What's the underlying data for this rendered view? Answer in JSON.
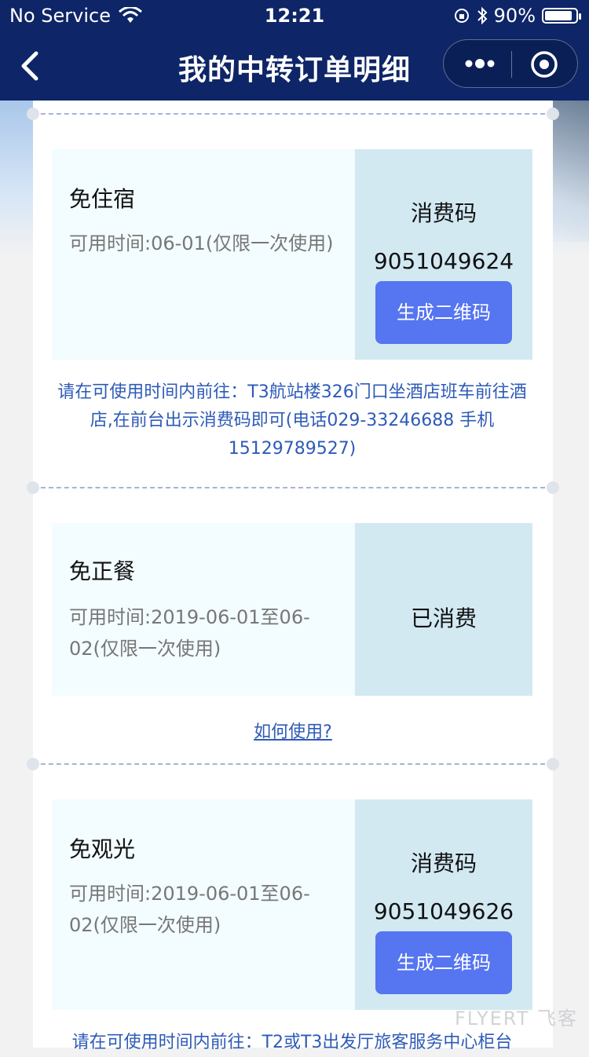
{
  "status_bar": {
    "carrier": "No Service",
    "time": "12:21",
    "battery": "90%",
    "battery_level": 0.9
  },
  "nav": {
    "title": "我的中转订单明细"
  },
  "coupons": [
    {
      "name": "免住宿",
      "time": "可用时间:06-01(仅限一次使用)",
      "code_label": "消费码",
      "code": "9051049624",
      "button": "生成二维码",
      "instructions": "请在可使用时间内前往：T3航站楼326门口坐酒店班车前往酒店,在前台出示消费码即可(电话029-33246688 手机15129789527)"
    },
    {
      "name": "免正餐",
      "time": "可用时间:2019-06-01至06-02(仅限一次使用)",
      "status": "已消费",
      "link": "如何使用?"
    },
    {
      "name": "免观光",
      "time": "可用时间:2019-06-01至06-02(仅限一次使用)",
      "code_label": "消费码",
      "code": "9051049626",
      "button": "生成二维码",
      "instructions": "请在可使用时间内前往：T2或T3出发厅旅客服务中心柜台"
    }
  ],
  "watermark": "FLYERT 飞客"
}
